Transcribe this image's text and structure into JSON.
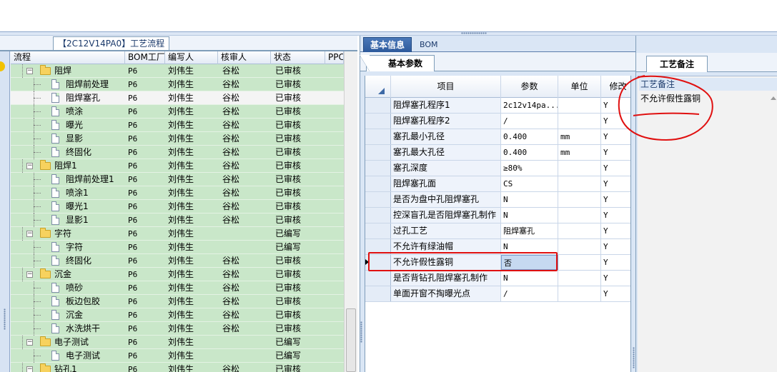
{
  "left_panel": {
    "caption": "【2C12V14PA0】工艺流程",
    "columns": [
      "流程",
      "BOM工厂",
      "编写人",
      "核审人",
      "状态",
      "PPC"
    ],
    "rows": [
      {
        "name": "阻焊",
        "level": 0,
        "kind": "folder",
        "factory": "P6",
        "writer": "刘伟生",
        "reviewer": "谷松",
        "status": "已审核"
      },
      {
        "name": "阻焊前处理",
        "level": 1,
        "kind": "doc",
        "factory": "P6",
        "writer": "刘伟生",
        "reviewer": "谷松",
        "status": "已审核"
      },
      {
        "name": "阻焊塞孔",
        "level": 1,
        "kind": "doc",
        "factory": "P6",
        "writer": "刘伟生",
        "reviewer": "谷松",
        "status": "已审核",
        "selected": true
      },
      {
        "name": "喷涂",
        "level": 1,
        "kind": "doc",
        "factory": "P6",
        "writer": "刘伟生",
        "reviewer": "谷松",
        "status": "已审核"
      },
      {
        "name": "曝光",
        "level": 1,
        "kind": "doc",
        "factory": "P6",
        "writer": "刘伟生",
        "reviewer": "谷松",
        "status": "已审核"
      },
      {
        "name": "显影",
        "level": 1,
        "kind": "doc",
        "factory": "P6",
        "writer": "刘伟生",
        "reviewer": "谷松",
        "status": "已审核"
      },
      {
        "name": "终固化",
        "level": 1,
        "kind": "doc",
        "factory": "P6",
        "writer": "刘伟生",
        "reviewer": "谷松",
        "status": "已审核"
      },
      {
        "name": "阻焊1",
        "level": 0,
        "kind": "folder",
        "factory": "P6",
        "writer": "刘伟生",
        "reviewer": "谷松",
        "status": "已审核"
      },
      {
        "name": "阻焊前处理1",
        "level": 1,
        "kind": "doc",
        "factory": "P6",
        "writer": "刘伟生",
        "reviewer": "谷松",
        "status": "已审核"
      },
      {
        "name": "喷涂1",
        "level": 1,
        "kind": "doc",
        "factory": "P6",
        "writer": "刘伟生",
        "reviewer": "谷松",
        "status": "已审核"
      },
      {
        "name": "曝光1",
        "level": 1,
        "kind": "doc",
        "factory": "P6",
        "writer": "刘伟生",
        "reviewer": "谷松",
        "status": "已审核"
      },
      {
        "name": "显影1",
        "level": 1,
        "kind": "doc",
        "factory": "P6",
        "writer": "刘伟生",
        "reviewer": "谷松",
        "status": "已审核"
      },
      {
        "name": "字符",
        "level": 0,
        "kind": "folder",
        "factory": "P6",
        "writer": "刘伟生",
        "reviewer": "",
        "status": "已编写"
      },
      {
        "name": "字符",
        "level": 1,
        "kind": "doc",
        "factory": "P6",
        "writer": "刘伟生",
        "reviewer": "",
        "status": "已编写"
      },
      {
        "name": "终固化",
        "level": 1,
        "kind": "doc",
        "factory": "P6",
        "writer": "刘伟生",
        "reviewer": "谷松",
        "status": "已审核"
      },
      {
        "name": "沉金",
        "level": 0,
        "kind": "folder",
        "factory": "P6",
        "writer": "刘伟生",
        "reviewer": "谷松",
        "status": "已审核"
      },
      {
        "name": "喷砂",
        "level": 1,
        "kind": "doc",
        "factory": "P6",
        "writer": "刘伟生",
        "reviewer": "谷松",
        "status": "已审核"
      },
      {
        "name": "板边包胶",
        "level": 1,
        "kind": "doc",
        "factory": "P6",
        "writer": "刘伟生",
        "reviewer": "谷松",
        "status": "已审核"
      },
      {
        "name": "沉金",
        "level": 1,
        "kind": "doc",
        "factory": "P6",
        "writer": "刘伟生",
        "reviewer": "谷松",
        "status": "已审核"
      },
      {
        "name": "水洗烘干",
        "level": 1,
        "kind": "doc",
        "factory": "P6",
        "writer": "刘伟生",
        "reviewer": "谷松",
        "status": "已审核"
      },
      {
        "name": "电子测试",
        "level": 0,
        "kind": "folder",
        "factory": "P6",
        "writer": "刘伟生",
        "reviewer": "",
        "status": "已编写"
      },
      {
        "name": "电子测试",
        "level": 1,
        "kind": "doc",
        "factory": "P6",
        "writer": "刘伟生",
        "reviewer": "",
        "status": "已编写"
      },
      {
        "name": "钻孔1",
        "level": 0,
        "kind": "folder",
        "factory": "P6",
        "writer": "刘伟生",
        "reviewer": "谷松",
        "status": "已审核"
      }
    ]
  },
  "middle_panel": {
    "tabs": [
      "基本信息",
      "BOM"
    ],
    "sub_tab": "基本参数",
    "columns": [
      "项目",
      "参数",
      "单位",
      "修改"
    ],
    "rows": [
      {
        "item": "阻焊塞孔程序1",
        "param": "2c12v14pa...",
        "unit": "",
        "modify": "Y"
      },
      {
        "item": "阻焊塞孔程序2",
        "param": "/",
        "unit": "",
        "modify": "Y"
      },
      {
        "item": "塞孔最小孔径",
        "param": "0.400",
        "unit": "mm",
        "modify": "Y"
      },
      {
        "item": "塞孔最大孔径",
        "param": "0.400",
        "unit": "mm",
        "modify": "Y"
      },
      {
        "item": "塞孔深度",
        "param": "≥80%",
        "unit": "",
        "modify": "Y"
      },
      {
        "item": "阻焊塞孔面",
        "param": "CS",
        "unit": "",
        "modify": "Y"
      },
      {
        "item": "是否为盘中孔阻焊塞孔",
        "param": "N",
        "unit": "",
        "modify": "Y"
      },
      {
        "item": "控深盲孔是否阻焊塞孔制作",
        "param": "N",
        "unit": "",
        "modify": "Y"
      },
      {
        "item": "过孔工艺",
        "param": "阻焊塞孔",
        "unit": "",
        "modify": "Y"
      },
      {
        "item": "不允许有绿油帽",
        "param": "N",
        "unit": "",
        "modify": "Y"
      },
      {
        "item": "不允许假性露铜",
        "param": "否",
        "unit": "",
        "modify": "Y",
        "selected": true
      },
      {
        "item": "是否背钻孔阻焊塞孔制作",
        "param": "N",
        "unit": "",
        "modify": "Y"
      },
      {
        "item": "单面开窗不掏曝光点",
        "param": "/",
        "unit": "",
        "modify": "Y"
      }
    ]
  },
  "right_panel": {
    "tab": "工艺备注",
    "label": "工艺备注",
    "text": "不允许假性露铜"
  },
  "colors": {
    "row_green": "#c9e7c9",
    "tab_active": "#2d5a9c",
    "annotation_red": "#e01010"
  }
}
